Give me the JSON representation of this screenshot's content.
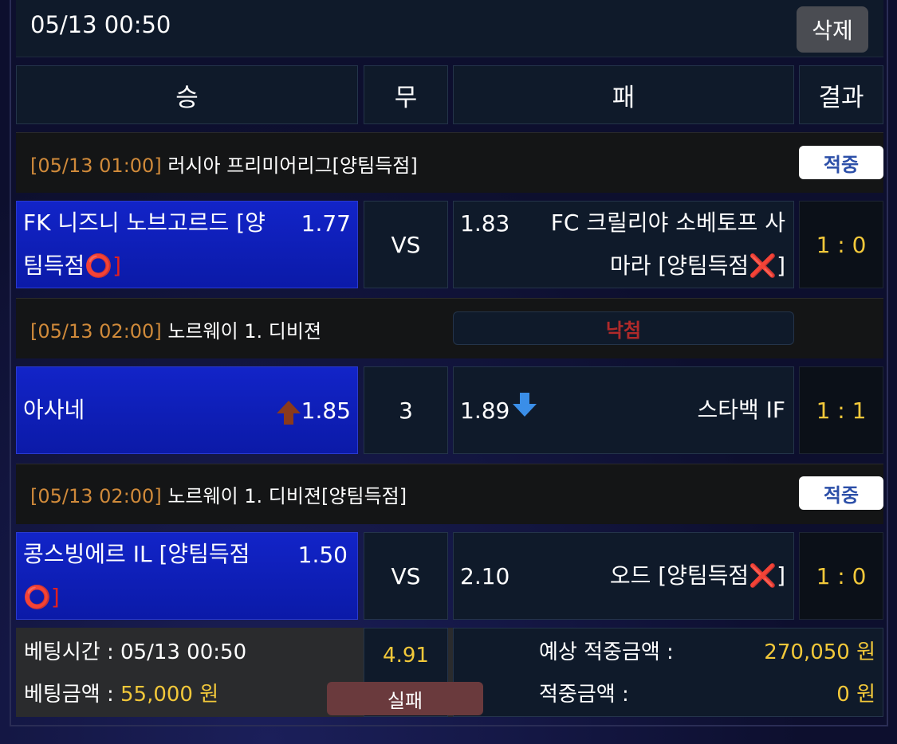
{
  "header": {
    "datetime": "05/13 00:50",
    "delete_label": "삭제"
  },
  "columns": {
    "win": "승",
    "draw": "무",
    "lose": "패",
    "result": "결과"
  },
  "matches": [
    {
      "league_time": "[05/13 01:00]",
      "league_name": "러시아 프리미어리그[양팀득점]",
      "status": "적중",
      "home_line1": "FK 니즈니 노브고르드 [양",
      "home_line2": "팀득점",
      "home_mark": "⭕]",
      "home_odd": "1.77",
      "draw": "VS",
      "away_odd": "1.83",
      "away_line1": "FC 크릴리야 소베토프 사",
      "away_line2": "마라 [양팀득점",
      "away_mark": "❌]",
      "result": "1 : 0"
    },
    {
      "league_time": "[05/13 02:00]",
      "league_name": "노르웨이 1. 디비젼",
      "status": "낙첨",
      "home_name": "아사네",
      "home_odd": "1.85",
      "draw": "3",
      "away_odd": "1.89",
      "away_name": "스타백 IF",
      "result": "1 : 1"
    },
    {
      "league_time": "[05/13 02:00]",
      "league_name": "노르웨이 1. 디비젼[양팀득점]",
      "status": "적중",
      "home_line1": "콩스빙에르 IL [양팀득점",
      "home_mark": "⭕]",
      "home_odd": "1.50",
      "draw": "VS",
      "away_odd": "2.10",
      "away_name": "오드 [양팀득점",
      "away_mark": "❌]",
      "result": "1 : 0"
    }
  ],
  "footer": {
    "bet_time_label": "베팅시간 : ",
    "bet_time_value": "05/13 00:50",
    "bet_amount_label": "베팅금액 : ",
    "bet_amount_value": "55,000 원",
    "total_odds": "4.91",
    "result_label": "실패",
    "expected_label": "예상 적중금액 :",
    "expected_value": "270,050 원",
    "win_amount_label": "적중금액 :",
    "win_amount_value": "0 원"
  },
  "colors": {
    "win_cell": "#0e1fb8",
    "gold": "#f2c83a",
    "league_time": "#d08a3a",
    "hit_badge": "#2c4fa8",
    "lose_badge": "#b02a2a"
  }
}
